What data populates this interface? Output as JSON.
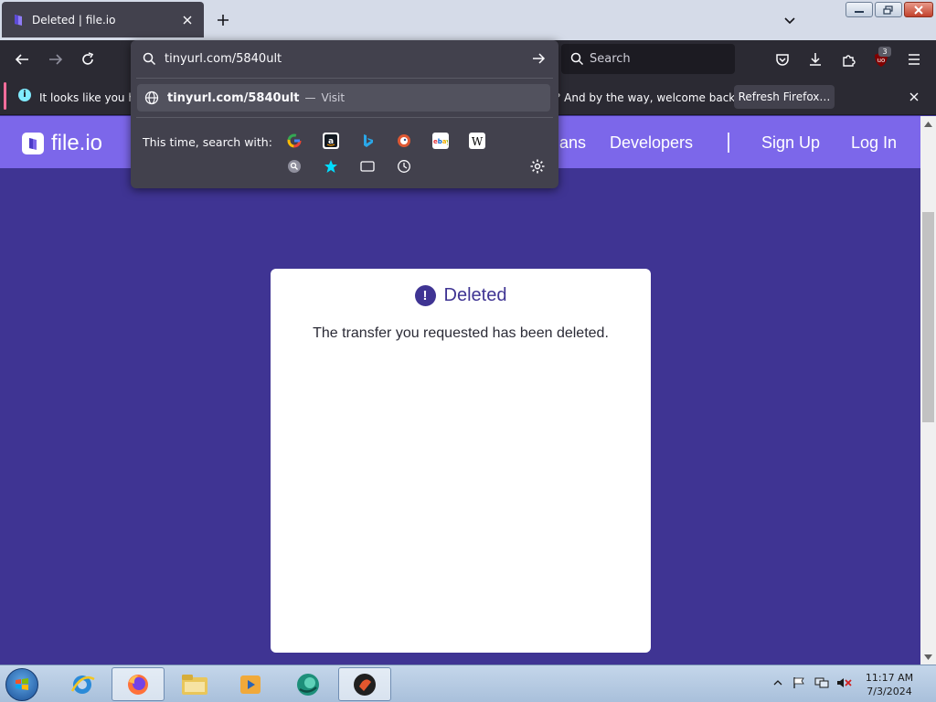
{
  "browser": {
    "tab": {
      "title": "Deleted | file.io",
      "favicon": "fileio-favicon"
    },
    "toolbar": {
      "search_placeholder": "Search",
      "extensions_badge": "3"
    },
    "notification": {
      "text_left": "It looks like you ha",
      "text_right": "? And by the way, welcome back!",
      "button_label": "Refresh Firefox…"
    },
    "url_panel": {
      "input_value": "tinyurl.com/5840ult",
      "suggestion_url": "tinyurl.com/5840ult",
      "suggestion_separator": "—",
      "suggestion_action": "Visit",
      "search_with_label": "This time, search with:",
      "engines_row1": [
        "google-icon",
        "amazon-icon",
        "bing-icon",
        "duckduckgo-icon",
        "ebay-icon",
        "wikipedia-icon"
      ],
      "engines_row2": [
        "search-engine-icon",
        "bookmarks-star-icon",
        "tabs-icon",
        "history-icon"
      ]
    }
  },
  "site": {
    "logo_text": "file.io",
    "nav": {
      "partial": "ans",
      "developers": "Developers",
      "separator": "|",
      "signup": "Sign Up",
      "login": "Log In"
    },
    "card": {
      "icon": "!",
      "title": "Deleted",
      "message": "The transfer you requested has been deleted."
    },
    "colors": {
      "header": "#7c67ea",
      "background": "#3f3493",
      "card": "#ffffff"
    }
  },
  "taskbar": {
    "time": "11:17 AM",
    "date": "7/3/2024",
    "pinned": [
      "ie-icon",
      "firefox-icon",
      "explorer-icon",
      "media-player-icon",
      "cyberlink-icon",
      "app-icon"
    ]
  }
}
